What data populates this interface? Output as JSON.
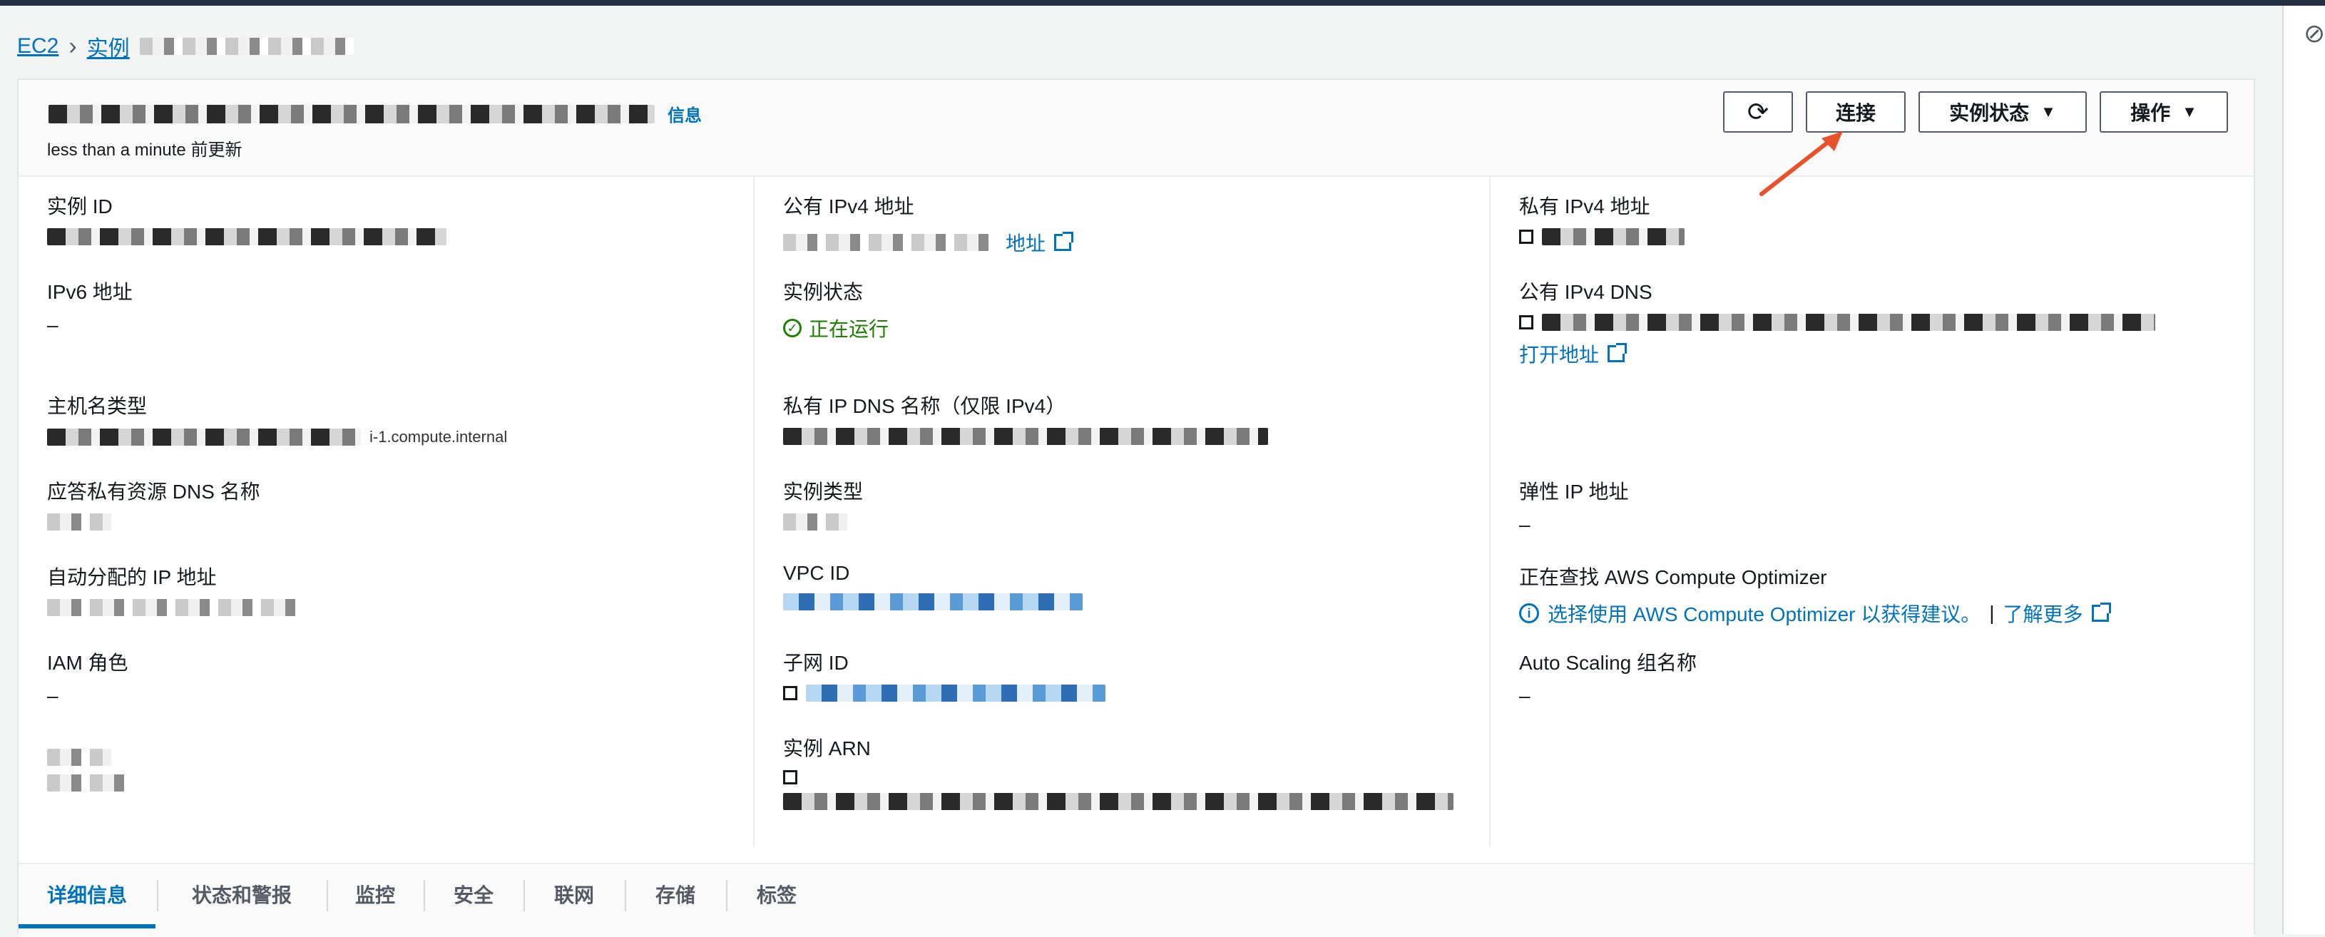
{
  "breadcrumb": {
    "root": "EC2",
    "section": "实例"
  },
  "header": {
    "info_label": "信息",
    "updated": "less than a minute 前更新",
    "buttons": {
      "connect": "连接",
      "instance_state": "实例状态",
      "actions": "操作"
    }
  },
  "details": {
    "col1": {
      "instance_id_label": "实例 ID",
      "ipv6_label": "IPv6 地址",
      "ipv6_value": "–",
      "hostname_type_label": "主机名类型",
      "hostname_partial": "i-1.compute.internal",
      "answer_dns_label": "应答私有资源 DNS 名称",
      "auto_ip_label": "自动分配的 IP 地址",
      "iam_label": "IAM 角色",
      "iam_value": "–"
    },
    "col2": {
      "public_ipv4_label": "公有 IPv4 地址",
      "public_ipv4_link": "地址",
      "state_label": "实例状态",
      "state_value": "正在运行",
      "private_dns_label": "私有 IP DNS 名称（仅限 IPv4）",
      "type_label": "实例类型",
      "vpc_label": "VPC ID",
      "subnet_label": "子网 ID",
      "arn_label": "实例 ARN"
    },
    "col3": {
      "private_ipv4_label": "私有 IPv4 地址",
      "public_dns_label": "公有 IPv4 DNS",
      "open_address": "打开地址",
      "elastic_ip_label": "弹性 IP 地址",
      "elastic_ip_value": "–",
      "optimizer_label": "正在查找 AWS Compute Optimizer",
      "optimizer_link": "选择使用 AWS Compute Optimizer 以获得建议。",
      "learn_more": "了解更多",
      "asg_label": "Auto Scaling 组名称",
      "asg_value": "–"
    }
  },
  "tabs": [
    "详细信息",
    "状态和警报",
    "监控",
    "安全",
    "联网",
    "存储",
    "标签"
  ],
  "colors": {
    "link": "#0073bb",
    "success": "#1d8102",
    "arrow": "#e8522a"
  }
}
